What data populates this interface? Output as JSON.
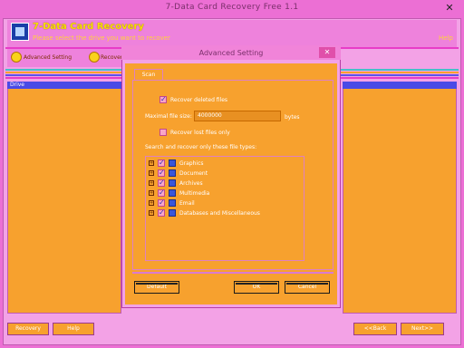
{
  "window": {
    "title": "7-Data Card Recovery Free 1.1",
    "close_glyph": "✕"
  },
  "header": {
    "app_name": "7-Data Card Recovery",
    "subtitle": "Please select the drive you want to recover",
    "help_link": "Help"
  },
  "toolbar": {
    "item1": "Advanced Setting",
    "item2": "Recovery"
  },
  "panels": {
    "left_header": "Drive"
  },
  "dialog": {
    "title": "Advanced Setting",
    "close_glyph": "✕",
    "tab": "Scan",
    "options": {
      "recover_deleted_label": "Recover deleted files",
      "recover_deleted_checked": true,
      "max_size_label": "Maximal file size:",
      "max_size_value": "4000000",
      "max_size_unit": "bytes",
      "recover_lost_only_label": "Recover lost files only",
      "recover_lost_only_checked": false,
      "file_types_label": "Search and recover only these file types:"
    },
    "file_types": [
      {
        "name": "Graphics"
      },
      {
        "name": "Document"
      },
      {
        "name": "Archives"
      },
      {
        "name": "Multimedia"
      },
      {
        "name": "Email"
      },
      {
        "name": "Databases and Miscellaneous"
      }
    ],
    "buttons": {
      "default": "Default",
      "ok": "OK",
      "cancel": "Cancel"
    }
  },
  "bottom_buttons": {
    "recovery": "Recovery",
    "help": "Help",
    "back": "<<Back",
    "next": "Next>>"
  },
  "colors": {
    "accent": "#ec6fd4",
    "panel": "#f7a12e",
    "checkbox_mark": "#2f2fbf",
    "header_text": "#f4e000"
  }
}
